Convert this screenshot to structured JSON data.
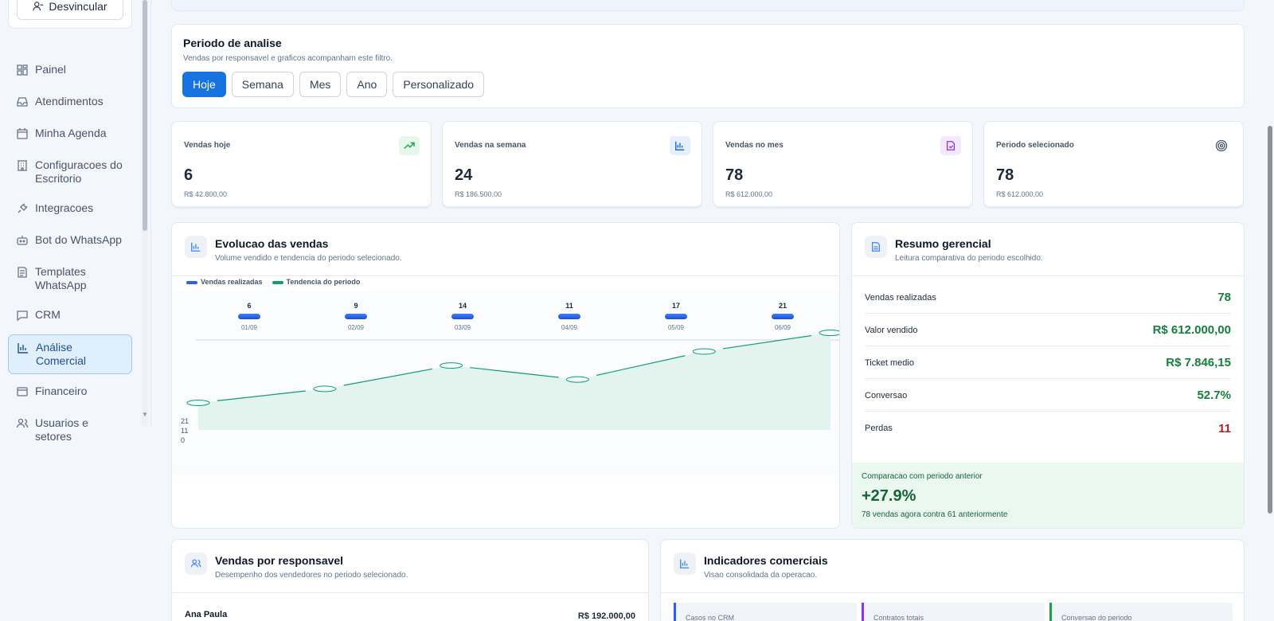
{
  "sidebar": {
    "unlink_label": "Desvincular",
    "items": [
      {
        "label": "Painel",
        "icon": "dashboard-icon"
      },
      {
        "label": "Atendimentos",
        "icon": "inbox-icon"
      },
      {
        "label": "Minha Agenda",
        "icon": "calendar-icon"
      },
      {
        "label": "Configuracoes do Escritorio",
        "icon": "building-icon"
      },
      {
        "label": "Integracoes",
        "icon": "plug-icon"
      },
      {
        "label": "Bot do WhatsApp",
        "icon": "bot-icon"
      },
      {
        "label": "Templates WhatsApp",
        "icon": "template-icon"
      },
      {
        "label": "CRM",
        "icon": "chat-icon"
      },
      {
        "label": "Análise Comercial",
        "icon": "bar-chart-icon",
        "active": true
      },
      {
        "label": "Financeiro",
        "icon": "wallet-icon"
      },
      {
        "label": "Usuarios e setores",
        "icon": "users-icon"
      }
    ]
  },
  "period": {
    "title": "Periodo de analise",
    "subtitle": "Vendas por responsavel e graficos acompanham este filtro.",
    "buttons": [
      "Hoje",
      "Semana",
      "Mes",
      "Ano",
      "Personalizado"
    ],
    "active": "Hoje"
  },
  "stats": [
    {
      "label": "Vendas hoje",
      "value": "6",
      "sub": "R$ 42.800,00",
      "icon": "trending-up-icon",
      "color": "#16a34a"
    },
    {
      "label": "Vendas na semana",
      "value": "24",
      "sub": "R$ 186.500,00",
      "icon": "bar-chart-icon",
      "color": "#2563eb"
    },
    {
      "label": "Vendas no mes",
      "value": "78",
      "sub": "R$ 612.000,00",
      "icon": "file-check-icon",
      "color": "#9333ea"
    },
    {
      "label": "Periodo selecionado",
      "value": "78",
      "sub": "R$ 612.000,00",
      "icon": "target-icon",
      "color": "#475569"
    }
  ],
  "evolution": {
    "title": "Evolucao das vendas",
    "subtitle": "Volume vendido e tendencia do periodo selecionado.",
    "legend": [
      "Vendas realizadas",
      "Tendencia do periodo"
    ],
    "y_ticks": [
      "21",
      "11",
      "0"
    ]
  },
  "chart_data": {
    "type": "bar",
    "categories": [
      "01/09",
      "02/09",
      "03/09",
      "04/09",
      "05/09",
      "06/09"
    ],
    "series": [
      {
        "name": "Vendas realizadas",
        "values": [
          6,
          9,
          14,
          11,
          17,
          21
        ]
      },
      {
        "name": "Tendencia do periodo",
        "values": [
          6,
          9,
          14,
          11,
          17,
          21
        ]
      }
    ],
    "ylim": [
      0,
      21
    ],
    "legend": "top-left"
  },
  "summary": {
    "title": "Resumo gerencial",
    "subtitle": "Leitura comparativa do periodo escolhido.",
    "rows": [
      {
        "k": "Vendas realizadas",
        "v": "78"
      },
      {
        "k": "Valor vendido",
        "v": "R$ 612.000,00"
      },
      {
        "k": "Ticket medio",
        "v": "R$ 7.846,15"
      },
      {
        "k": "Conversao",
        "v": "52.7%"
      },
      {
        "k": "Perdas",
        "v": "11"
      }
    ],
    "compare_title": "Comparacao com periodo anterior",
    "compare_value": "+27.9%",
    "compare_sub": "78 vendas agora contra 61 anteriormente"
  },
  "responsible": {
    "title": "Vendas por responsavel",
    "subtitle": "Desempenho dos vendedores no periodo selecionado.",
    "first_name": "Ana Paula",
    "first_value": "R$ 192.000,00"
  },
  "indicators": {
    "title": "Indicadores comerciais",
    "subtitle": "Visao consolidada da operacao.",
    "boxes": [
      "Casos no CRM",
      "Contratos totais",
      "Conversao do periodo"
    ],
    "colors": [
      "#2563eb",
      "#9333ea",
      "#16a34a"
    ]
  }
}
